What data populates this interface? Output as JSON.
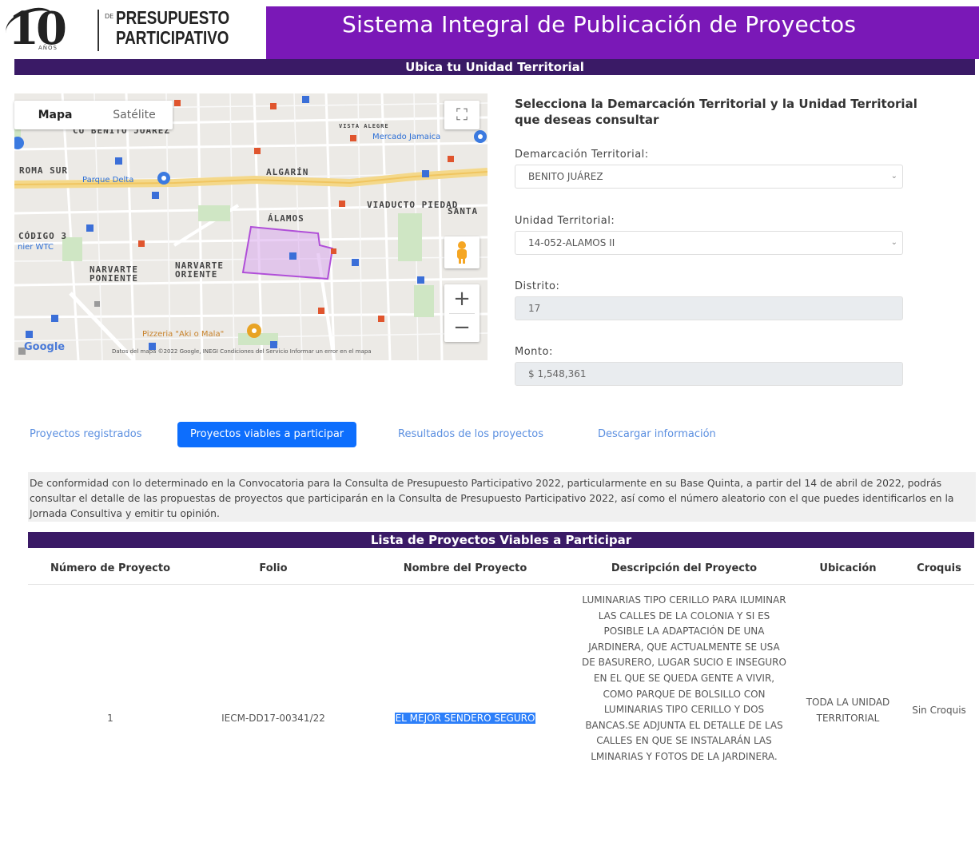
{
  "logo": {
    "numeral": "10",
    "anos": "AÑOS",
    "de": "DE",
    "title_line1": "PRESUPUESTO",
    "title_line2": "PARTICIPATIVO"
  },
  "header": {
    "title": "Sistema Integral de Publicación de Proyectos"
  },
  "section_title": "Ubica tu Unidad Territorial",
  "map": {
    "type_buttons": {
      "map": "Mapa",
      "satellite": "Satélite"
    },
    "labels": {
      "cu_benito_juarez": "CU BENITO JUÁREZ",
      "roma_sur": "ROMA SUR",
      "parque_delta": "Parque Delta",
      "algarin": "ALGARÍN",
      "mercado_jamaica": "Mercado Jamaica",
      "vista_alegre": "VISTA ALEGRE",
      "viaducto_piedad": "VIADUCTO PIEDAD",
      "santa": "SANTA",
      "alamos": "ÁLAMOS",
      "codigo": "CÓDIGO 3",
      "wtc": "nier WTC",
      "narvarte_poniente": "NARVARTE PONIENTE",
      "narvarte_oriente": "NARVARTE ORIENTE",
      "poi": "Pizzeria \"Aki o Mala\""
    },
    "attribution": "Google",
    "footer": "Datos del mapa ©2022 Google, INEGI    Condiciones del Servicio    Informar un error en el mapa",
    "zoom_in": "+",
    "zoom_out": "−",
    "highlight_color": "#c47ee0"
  },
  "form": {
    "heading": "Selecciona la Demarcación Territorial y la Unidad Territorial que deseas consultar",
    "demarcacion_label": "Demarcación Territorial:",
    "demarcacion_value": "BENITO JUÁREZ",
    "unidad_label": "Unidad Territorial:",
    "unidad_value": "14-052-ALAMOS II",
    "distrito_label": "Distrito:",
    "distrito_value": "17",
    "monto_label": "Monto:",
    "monto_value": "$ 1,548,361"
  },
  "tabs": [
    {
      "label": "Proyectos registrados"
    },
    {
      "label": "Proyectos viables a participar"
    },
    {
      "label": "Resultados de los proyectos"
    },
    {
      "label": "Descargar información"
    }
  ],
  "info_text": "De conformidad con lo determinado en la Convocatoria para la Consulta de Presupuesto Participativo 2022, particularmente en su Base Quinta, a partir del 14 de abril de 2022, podrás consultar el detalle de las propuestas de proyectos que participarán en la Consulta de Presupuesto Participativo 2022, así como el número aleatorio con el que puedes identificarlos en la Jornada Consultiva y emitir tu opinión.",
  "list_title": "Lista de Proyectos Viables a Participar",
  "table": {
    "headers": [
      "Número de Proyecto",
      "Folio",
      "Nombre del Proyecto",
      "Descripción del Proyecto",
      "Ubicación",
      "Croquis"
    ],
    "rows": [
      {
        "numero": "1",
        "folio": "IECM-DD17-00341/22",
        "nombre": "EL MEJOR SENDERO SEGURO",
        "descripcion": "LUMINARIAS TIPO CERILLO PARA ILUMINAR LAS CALLES DE LA COLONIA Y SI ES POSIBLE LA ADAPTACIÓN DE UNA JARDINERA, QUE ACTUALMENTE SE USA DE BASURERO, LUGAR SUCIO E INSEGURO EN EL QUE SE QUEDA GENTE A VIVIR, COMO PARQUE DE BOLSILLO CON LUMINARIAS TIPO CERILLO Y DOS BANCAS.SE ADJUNTA EL DETALLE DE LAS CALLES EN QUE SE INSTALARÁN LAS LMINARIAS Y FOTOS DE LA JARDINERA.",
        "ubicacion": "TODA LA UNIDAD TERRITORIAL",
        "croquis": "Sin Croquis"
      }
    ]
  },
  "colors": {
    "header_purple": "#7a18b7",
    "dark_bar": "#3a1a66",
    "tab_active": "#0d6efd",
    "tab_link": "#5b8fe0",
    "text_selection": "#2d7ff9"
  }
}
